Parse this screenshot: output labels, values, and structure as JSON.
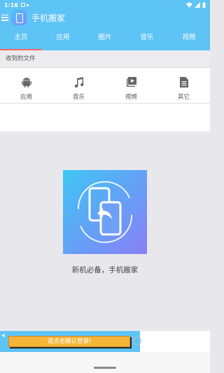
{
  "status": {
    "time": "1:16"
  },
  "appbar": {
    "title": "手机搬家"
  },
  "tabs": [
    {
      "label": "主页",
      "active": true
    },
    {
      "label": "应用"
    },
    {
      "label": "图片"
    },
    {
      "label": "音乐"
    },
    {
      "label": "视频"
    }
  ],
  "received": {
    "label": "收到的文件"
  },
  "categories": [
    {
      "label": "应用",
      "icon": "android-icon"
    },
    {
      "label": "音乐",
      "icon": "music-icon"
    },
    {
      "label": "视频",
      "icon": "video-icon"
    },
    {
      "label": "其它",
      "icon": "document-icon"
    }
  ],
  "slogan": "新机必备，手机搬家",
  "login": {
    "label": "请点击确认登录!"
  },
  "colors": {
    "primary": "#5ec3f5",
    "tab_indicator": "#f06b6b",
    "login_button": "#f5b638"
  }
}
